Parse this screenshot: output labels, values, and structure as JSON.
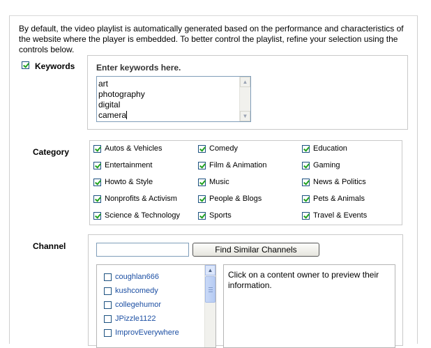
{
  "intro": "By default, the video playlist is automatically generated based on the performance and characteristics of the website where the player is embedded. To better control the playlist, refine your selection using the controls below.",
  "keywords": {
    "label": "Keywords",
    "checked": true,
    "title": "Enter keywords here.",
    "lines": [
      "art",
      "photography",
      "digital",
      "camera"
    ]
  },
  "category": {
    "label": "Category",
    "items": [
      "Autos & Vehicles",
      "Comedy",
      "Education",
      "Entertainment",
      "Film & Animation",
      "Gaming",
      "Howto & Style",
      "Music",
      "News & Politics",
      "Nonprofits & Activism",
      "People & Blogs",
      "Pets & Animals",
      "Science & Technology",
      "Sports",
      "Travel & Events"
    ]
  },
  "channel": {
    "label": "Channel",
    "search_value": "",
    "button_label": "Find Similar Channels",
    "list": [
      "coughlan666",
      "kushcomedy",
      "collegehumor",
      "JPizzle1122",
      "ImprovEverywhere"
    ],
    "preview_text": "Click on a content owner to preview their information."
  },
  "icons": {
    "scroll_up": "chevron-up-icon",
    "scroll_down": "chevron-down-icon",
    "check": "checkmark-icon"
  },
  "colors": {
    "check_green": "#21a121",
    "link_blue": "#1c4fa3",
    "input_border": "#7f9db9"
  }
}
